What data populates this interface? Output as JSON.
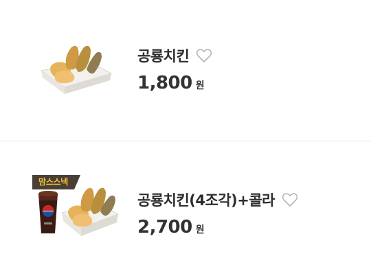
{
  "items": [
    {
      "name": "공룡치킨",
      "price": "1,800",
      "currency": "원",
      "badge": null,
      "favorite_icon": "heart-outline-icon"
    },
    {
      "name": "공룡치킨(4조각)+콜라",
      "price": "2,700",
      "currency": "원",
      "badge": "맘스스낵",
      "favorite_icon": "heart-outline-icon"
    }
  ],
  "colors": {
    "badge_bg": "#4a3f35",
    "badge_text": "#f4c33a",
    "heart_stroke": "#b5b5b5",
    "divider": "#e6e6e6"
  }
}
